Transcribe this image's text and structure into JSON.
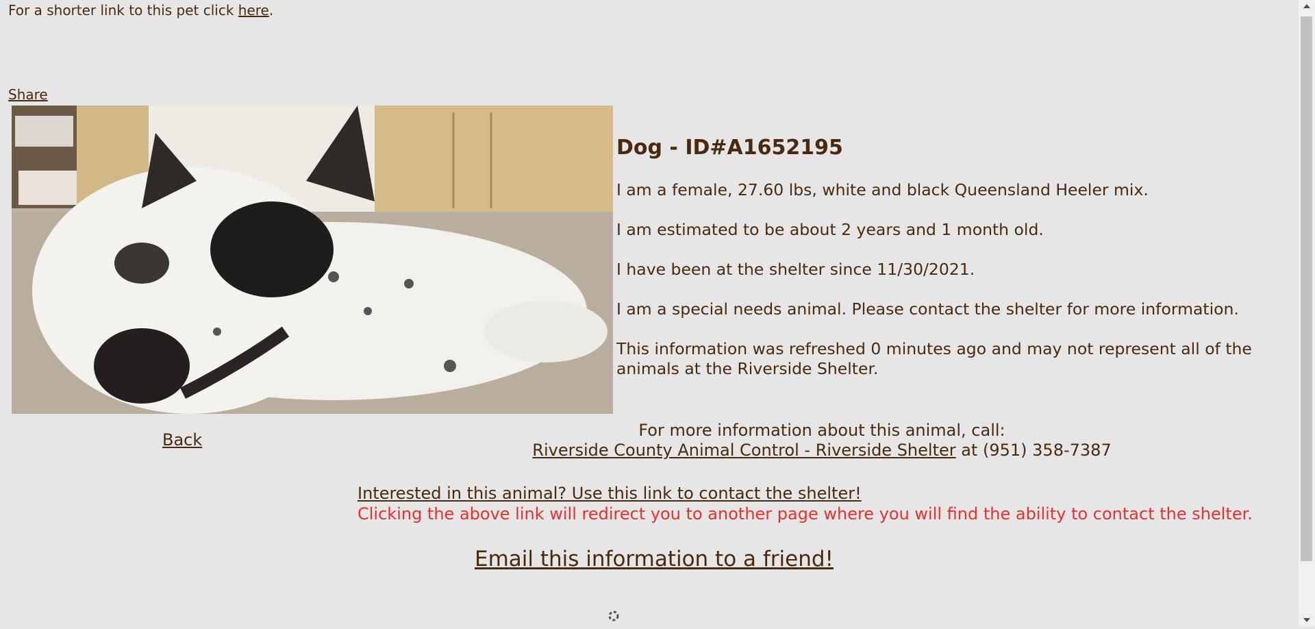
{
  "header": {
    "shorter_link_prefix": "For a shorter link to this pet click ",
    "shorter_link_label": "here",
    "shorter_link_suffix": ".",
    "share_label": "Share"
  },
  "pet": {
    "title": "Dog - ID#A1652195",
    "desc_1": "I am a female, 27.60 lbs, white and black Queensland Heeler mix.",
    "desc_2": "I am estimated to be about 2 years and 1 month old.",
    "desc_3": "I have been at the shelter since 11/30/2021.",
    "desc_4": "I am a special needs animal. Please contact the shelter for more information.",
    "desc_5": "This information was refreshed 0 minutes ago and may not represent all of the animals at the Riverside Shelter."
  },
  "nav": {
    "back_label": "Back"
  },
  "contact": {
    "call_line": "For more information about this animal, call:",
    "shelter_link": "Riverside County Animal Control - Riverside Shelter",
    "phone_text": " at (951) 358-7387",
    "interested_link": "Interested in this animal? Use this link to contact the shelter!",
    "redirect_note": "Clicking the above link will redirect you to another page where you will find the ability to contact the shelter.",
    "email_link": "Email this information to a friend!"
  },
  "colors": {
    "background": "#e6e6e6",
    "text": "#4a2a0e",
    "warning": "#e6302b"
  }
}
